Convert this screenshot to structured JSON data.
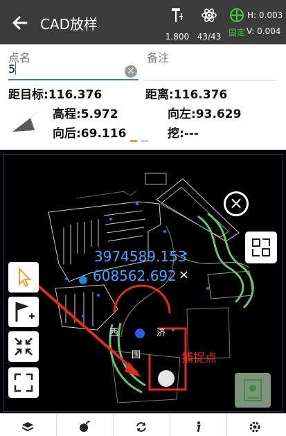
{
  "header": {
    "title": "CAD放样",
    "antenna_height": "1.800",
    "satellites": "43/43",
    "fix_status": "固定",
    "h_precision": "H: 0.003",
    "v_precision": "V: 0.004",
    "colors": {
      "bar": "#3b3b3b",
      "fix": "#3fc43f"
    }
  },
  "info": {
    "point_name_label": "点名",
    "point_name_value": "5",
    "remark_label": "备注",
    "distance_to_target": "距目标:116.376",
    "distance": "距离:116.376",
    "elevation": "高程:5.972",
    "left": "向左:93.629",
    "back": "向后:69.116",
    "cut": "挖:---"
  },
  "map": {
    "coord_north": "3974589.153",
    "coord_east": "608562.692",
    "capture_label": "捕捉点",
    "icons": {
      "close": "close-icon",
      "zoom_fit": "zoom-fit-icon",
      "select": "select-arrow-icon",
      "add_flag": "add-flag-icon",
      "zoom_in": "zoom-in-icon",
      "full_extent": "full-extent-icon",
      "locate": "locate-icon"
    }
  },
  "bottombar": {
    "icons": [
      "layers-icon",
      "measure-icon",
      "refresh-icon",
      "info-icon",
      "settings-icon"
    ]
  }
}
